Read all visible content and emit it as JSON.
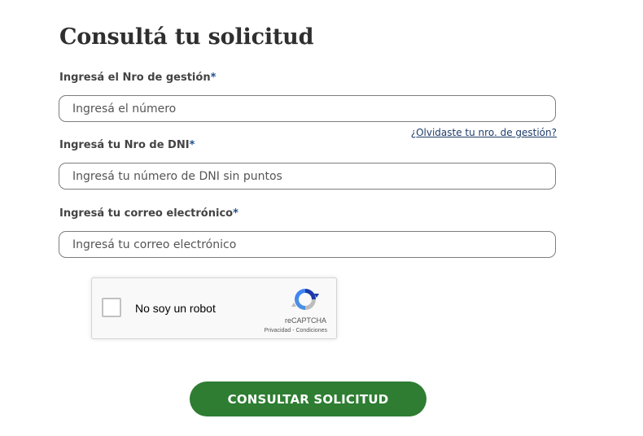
{
  "form": {
    "title": "Consultá tu solicitud",
    "gestion": {
      "label": "Ingresá el Nro de gestión",
      "required_mark": "*",
      "placeholder": "Ingresá el número",
      "value": ""
    },
    "forgot_link": "¿Olvidaste tu nro. de gestión?",
    "dni": {
      "label": "Ingresá tu Nro de DNI",
      "required_mark": "*",
      "placeholder": "Ingresá tu número de DNI sin puntos",
      "value": ""
    },
    "email": {
      "label": "Ingresá tu correo electrónico",
      "required_mark": "*",
      "placeholder": "Ingresá tu correo electrónico",
      "value": ""
    },
    "submit_label": "CONSULTAR SOLICITUD"
  },
  "recaptcha": {
    "checkbox_label": "No soy un robot",
    "brand": "reCAPTCHA",
    "terms": "Privacidad - Condiciones",
    "icon": "recaptcha-logo-icon"
  },
  "colors": {
    "accent_green": "#2e7d32",
    "link_blue": "#1f3d6b",
    "required_blue": "#1f4f8a"
  }
}
